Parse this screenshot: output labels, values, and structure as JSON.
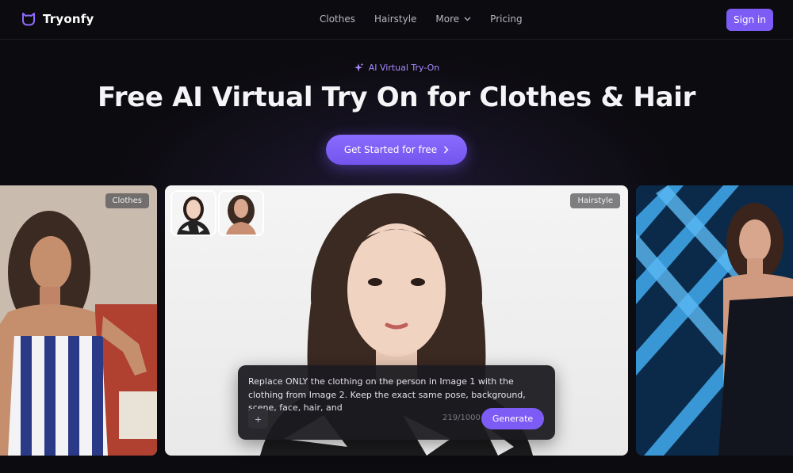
{
  "brand": {
    "name": "Tryonfy",
    "accent": "#7d5cf5"
  },
  "nav": {
    "links": [
      {
        "label": "Clothes"
      },
      {
        "label": "Hairstyle"
      },
      {
        "label": "More"
      },
      {
        "label": "Pricing"
      }
    ],
    "signin_label": "Sign in"
  },
  "hero": {
    "tag": "AI Virtual Try-On",
    "title": "Free AI Virtual Try On for Clothes & Hair",
    "cta_label": "Get Started for free"
  },
  "cards": {
    "left_badge": "Clothes",
    "center_badge": "Hairstyle"
  },
  "prompt": {
    "text": "Replace ONLY the clothing on the person in Image 1 with the clothing from Image 2. Keep the exact same pose, background, scene, face, hair, and",
    "plus_label": "+",
    "counter": "219/1000",
    "generate_label": "Generate"
  }
}
